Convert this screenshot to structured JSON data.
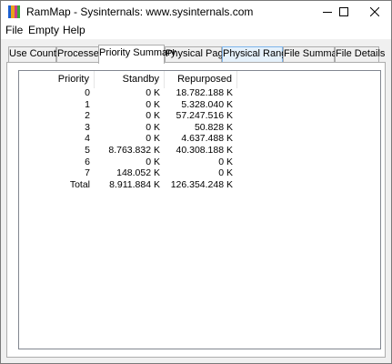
{
  "window": {
    "title": "RamMap - Sysinternals: www.sysinternals.com",
    "icon": "rammap-app-icon",
    "icon_colors": [
      "#1c5fd1",
      "#e8a21a",
      "#c93a8a",
      "#38a83a"
    ],
    "controls": [
      "minimize-icon",
      "maximize-icon",
      "close-icon"
    ]
  },
  "menu": {
    "file": "File",
    "empty": "Empty",
    "help": "Help"
  },
  "tabs": [
    {
      "label": "Use Counts"
    },
    {
      "label": "Processes"
    },
    {
      "label": "Priority Summary"
    },
    {
      "label": "Physical Pages"
    },
    {
      "label": "Physical Ranges"
    },
    {
      "label": "File Summary"
    },
    {
      "label": "File Details"
    }
  ],
  "active_tab": "Priority Summary",
  "hover_tab": "Physical Ranges",
  "table": {
    "columns": [
      "Priority",
      "Standby",
      "Repurposed"
    ],
    "rows": [
      [
        "0",
        "0 K",
        "18.782.188 K"
      ],
      [
        "1",
        "0 K",
        "5.328.040 K"
      ],
      [
        "2",
        "0 K",
        "57.247.516 K"
      ],
      [
        "3",
        "0 K",
        "50.828 K"
      ],
      [
        "4",
        "0 K",
        "4.637.488 K"
      ],
      [
        "5",
        "8.763.832 K",
        "40.308.188 K"
      ],
      [
        "6",
        "0 K",
        "0 K"
      ],
      [
        "7",
        "148.052 K",
        "0 K"
      ],
      [
        "Total",
        "8.911.884 K",
        "126.354.248 K"
      ]
    ]
  }
}
